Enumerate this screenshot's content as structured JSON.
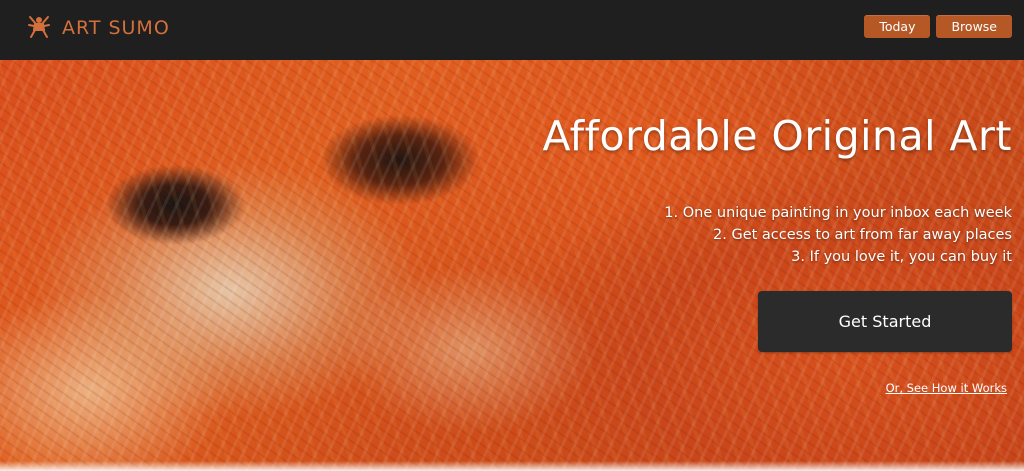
{
  "header": {
    "brand": "ART SUMO",
    "logo_icon": "sumo-figure-icon",
    "nav": [
      {
        "label": "Today"
      },
      {
        "label": "Browse"
      }
    ]
  },
  "hero": {
    "headline": "Affordable Original Art",
    "steps": [
      "1. One unique painting in your inbox each week",
      "2. Get access to art from far away places",
      "3. If you love it, you can buy it"
    ],
    "cta_label": "Get Started",
    "secondary_link": "Or, See How it Works"
  },
  "colors": {
    "brand_orange": "#d4703c",
    "nav_button": "#b65726",
    "header_bg": "#1f1f1f",
    "cta_bg": "#2b2b2b"
  }
}
